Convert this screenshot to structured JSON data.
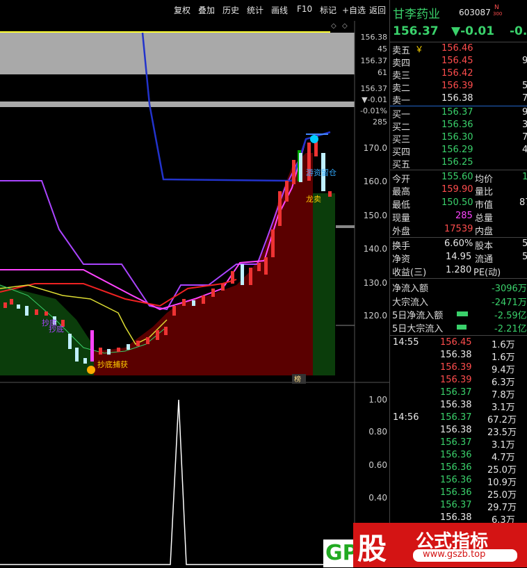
{
  "toolbar": {
    "buttons": [
      "复权",
      "叠加",
      "历史",
      "统计",
      "画线",
      "F10",
      "标记",
      "+自选",
      "返回"
    ]
  },
  "stock": {
    "name": "甘李药业",
    "code": "603087",
    "badge_top": "N",
    "badge_bottom": "300",
    "price": "156.37",
    "change": "▼-0.01",
    "change_pct_partial": "-0.0"
  },
  "mini_axis": {
    "labels": [
      "156.38",
      "45",
      "156.37",
      "61",
      "156.37",
      "▼-0.01",
      "-0.01%",
      "285"
    ]
  },
  "price_axis": {
    "labels": [
      "170.0",
      "160.0",
      "150.0",
      "140.0",
      "130.0",
      "120.0"
    ]
  },
  "indicator_axis": {
    "labels": [
      "1.00",
      "0.80",
      "0.60",
      "0.40"
    ]
  },
  "chart_annotations": {
    "buy_signal": "抄底",
    "buy_signal2": "抄底",
    "bottom_label": "抄底捕获",
    "top_label": "游资留仓",
    "sell_label": "龙卖",
    "rank_tag": "榜"
  },
  "orderbook": {
    "asks": [
      {
        "label": "卖五",
        "yen": "￥",
        "price": "156.46",
        "vol": ""
      },
      {
        "label": "卖四",
        "price": "156.45",
        "vol": "9"
      },
      {
        "label": "卖三",
        "price": "156.42",
        "vol": ""
      },
      {
        "label": "卖二",
        "price": "156.39",
        "vol": "5"
      },
      {
        "label": "卖一",
        "price": "156.38",
        "vol": "7"
      }
    ],
    "bids": [
      {
        "label": "买一",
        "price": "156.37",
        "vol": "9"
      },
      {
        "label": "买二",
        "price": "156.36",
        "vol": "3"
      },
      {
        "label": "买三",
        "price": "156.30",
        "vol": "7"
      },
      {
        "label": "买四",
        "price": "156.29",
        "vol": "4"
      },
      {
        "label": "买五",
        "price": "156.25",
        "vol": ""
      }
    ]
  },
  "quote": [
    {
      "l1": "今开",
      "v1": "155.60",
      "c1": "g",
      "l2": "均价",
      "v2": "1"
    },
    {
      "l1": "最高",
      "v1": "159.90",
      "c1": "r",
      "l2": "量比",
      "v2": ""
    },
    {
      "l1": "最低",
      "v1": "150.50",
      "c1": "g",
      "l2": "市值",
      "v2": "87"
    },
    {
      "l1": "现量",
      "v1": "285",
      "c1": "m",
      "l2": "总量",
      "v2": ""
    },
    {
      "l1": "外盘",
      "v1": "17539",
      "c1": "r",
      "l2": "内盘",
      "v2": ""
    }
  ],
  "fund": [
    {
      "l1": "换手",
      "v1": "6.60%",
      "l2": "股本",
      "v2": "5"
    },
    {
      "l1": "净资",
      "v1": "14.95",
      "l2": "流通",
      "v2": "5"
    },
    {
      "l1": "收益(三)",
      "v1": "1.280",
      "l2": "PE(动)",
      "v2": ""
    }
  ],
  "flows": [
    {
      "label": "净流入额",
      "value": "-3096万"
    },
    {
      "label": "大宗流入",
      "value": "-2471万"
    },
    {
      "label": "5日净流入额",
      "value": "-2.59亿"
    },
    {
      "label": "5日大宗流入",
      "value": "-2.21亿"
    }
  ],
  "ticks": [
    {
      "time": "14:55",
      "price": "156.45",
      "pc": "r",
      "vol": "1.6万"
    },
    {
      "time": "",
      "price": "156.38",
      "pc": "w",
      "vol": "1.6万"
    },
    {
      "time": "",
      "price": "156.39",
      "pc": "r",
      "vol": "9.4万"
    },
    {
      "time": "",
      "price": "156.39",
      "pc": "r",
      "vol": "6.3万"
    },
    {
      "time": "",
      "price": "156.37",
      "pc": "g",
      "vol": "7.8万"
    },
    {
      "time": "",
      "price": "156.38",
      "pc": "w",
      "vol": "3.1万"
    },
    {
      "time": "14:56",
      "price": "156.37",
      "pc": "g",
      "vol": "67.2万"
    },
    {
      "time": "",
      "price": "156.38",
      "pc": "w",
      "vol": "23.5万"
    },
    {
      "time": "",
      "price": "156.37",
      "pc": "g",
      "vol": "3.1万"
    },
    {
      "time": "",
      "price": "156.36",
      "pc": "g",
      "vol": "4.7万"
    },
    {
      "time": "",
      "price": "156.36",
      "pc": "g",
      "vol": "25.0万"
    },
    {
      "time": "",
      "price": "156.36",
      "pc": "g",
      "vol": "10.9万"
    },
    {
      "time": "",
      "price": "156.36",
      "pc": "g",
      "vol": "25.0万"
    },
    {
      "time": "",
      "price": "156.37",
      "pc": "g",
      "vol": "29.7万"
    },
    {
      "time": "",
      "price": "156.38",
      "pc": "w",
      "vol": "6.3万"
    }
  ],
  "watermark": {
    "left_text": "GP",
    "char": "股",
    "title": "公式指标",
    "url": "www.gszb.top"
  }
}
